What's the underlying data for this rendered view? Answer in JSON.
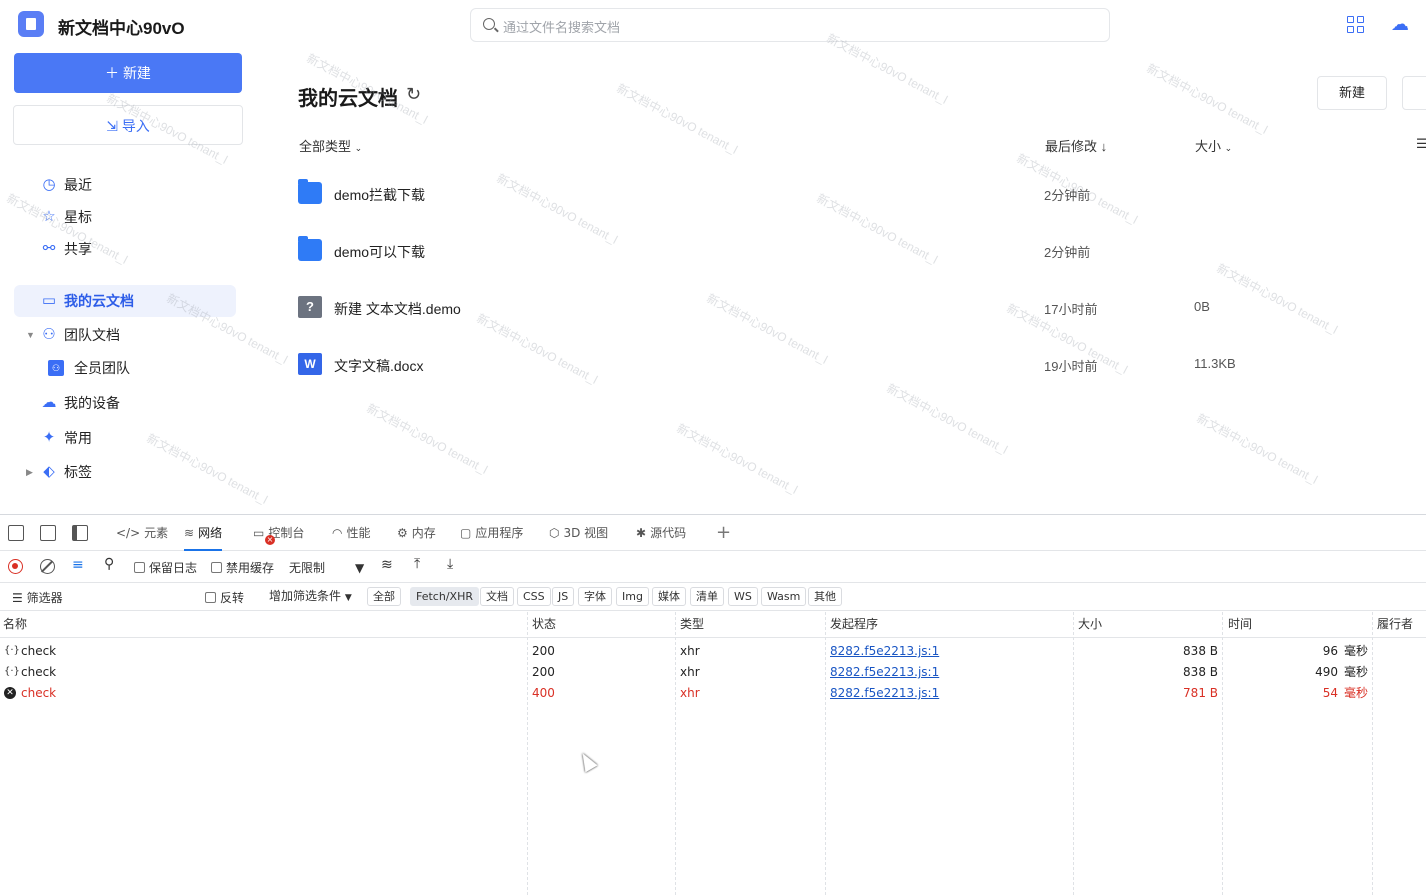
{
  "app": {
    "title": "新文档中心90vO",
    "search_placeholder": "通过文件名搜索文档",
    "new_button": "新建",
    "import_button": "导入",
    "new_icon": "plus-icon",
    "import_icon": "import-icon"
  },
  "sidebar": {
    "items": [
      {
        "label": "最近",
        "icon": "clock-icon"
      },
      {
        "label": "星标",
        "icon": "star-icon"
      },
      {
        "label": "共享",
        "icon": "share-icon"
      },
      {
        "label": "我的云文档",
        "icon": "folder-icon",
        "active": true
      },
      {
        "label": "团队文档",
        "icon": "team-icon"
      },
      {
        "label": "全员团队",
        "icon": "team-folder-icon"
      },
      {
        "label": "我的设备",
        "icon": "cloud-device-icon"
      },
      {
        "label": "常用",
        "icon": "pin-icon"
      },
      {
        "label": "标签",
        "icon": "tag-icon"
      }
    ]
  },
  "main": {
    "title": "我的云文档",
    "new_button": "新建",
    "filter_type": "全部类型",
    "col_modified": "最后修改",
    "col_size": "大小",
    "files": [
      {
        "name": "demo拦截下载",
        "type": "folder",
        "modified": "2分钟前",
        "size": ""
      },
      {
        "name": "demo可以下载",
        "type": "folder",
        "modified": "2分钟前",
        "size": ""
      },
      {
        "name": "新建 文本文档.demo",
        "type": "unknown",
        "modified": "17小时前",
        "size": "0B"
      },
      {
        "name": "文字文稿.docx",
        "type": "word",
        "modified": "19小时前",
        "size": "11.3KB"
      }
    ],
    "watermark": "新文档中心90vO tenant_l"
  },
  "devtools": {
    "tabs": [
      {
        "label": "元素",
        "icon": "code-icon"
      },
      {
        "label": "网络",
        "icon": "wifi-icon",
        "active": true
      },
      {
        "label": "控制台",
        "icon": "console-icon"
      },
      {
        "label": "性能",
        "icon": "performance-icon"
      },
      {
        "label": "内存",
        "icon": "memory-icon"
      },
      {
        "label": "应用程序",
        "icon": "application-icon"
      },
      {
        "label": "3D 视图",
        "icon": "3d-icon"
      },
      {
        "label": "源代码",
        "icon": "bug-icon"
      }
    ],
    "toolbar": {
      "preserve_log": "保留日志",
      "disable_cache": "禁用缓存",
      "throttle": "无限制"
    },
    "filterbar": {
      "filter_label": "筛选器",
      "invert": "反转",
      "more_filters": "增加筛选条件",
      "chips": [
        "全部",
        "Fetch/XHR",
        "文档",
        "CSS",
        "JS",
        "字体",
        "Img",
        "媒体",
        "清单",
        "WS",
        "Wasm",
        "其他"
      ],
      "selected_chip": "Fetch/XHR"
    },
    "columns": [
      "名称",
      "状态",
      "类型",
      "发起程序",
      "大小",
      "时间",
      "履行者"
    ],
    "rows": [
      {
        "name": "check",
        "status": "200",
        "type": "xhr",
        "initiator": "8282.f5e2213.js:1",
        "size": "838 B",
        "time": "96",
        "time_unit": "毫秒",
        "error": false
      },
      {
        "name": "check",
        "status": "200",
        "type": "xhr",
        "initiator": "8282.f5e2213.js:1",
        "size": "838 B",
        "time": "490",
        "time_unit": "毫秒",
        "error": false
      },
      {
        "name": "check",
        "status": "400",
        "type": "xhr",
        "initiator": "8282.f5e2213.js:1",
        "size": "781 B",
        "time": "54",
        "time_unit": "毫秒",
        "error": true
      }
    ],
    "colors": {
      "accent": "#1a73e8",
      "error": "#d93025",
      "link": "#1a56c4"
    }
  }
}
